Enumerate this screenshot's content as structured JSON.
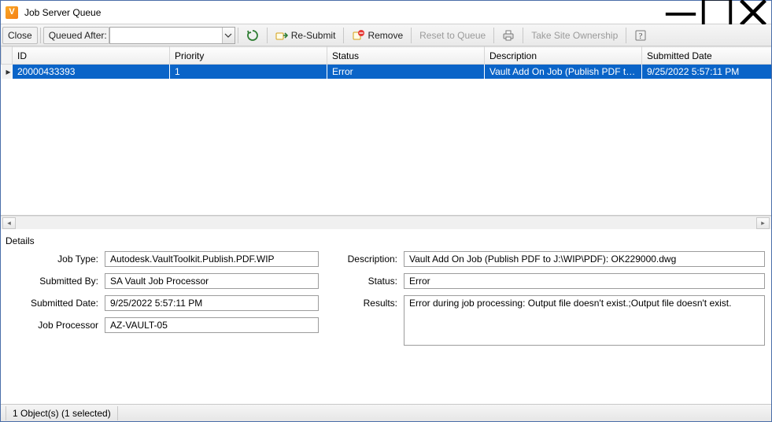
{
  "window": {
    "title": "Job Server Queue",
    "app_icon_letter": "V"
  },
  "toolbar": {
    "close": "Close",
    "queued_after": "Queued After:",
    "resubmit": "Re-Submit",
    "remove": "Remove",
    "reset": "Reset to Queue",
    "take_ownership": "Take Site Ownership"
  },
  "columns": {
    "id": "ID",
    "priority": "Priority",
    "status": "Status",
    "description": "Description",
    "submitted_date": "Submitted Date"
  },
  "rows": [
    {
      "id": "20000433393",
      "priority": "1",
      "status": "Error",
      "description": "Vault Add On Job (Publish PDF to J:...",
      "submitted_date": "9/25/2022 5:57:11 PM"
    }
  ],
  "details": {
    "header": "Details",
    "labels": {
      "job_type": "Job Type:",
      "submitted_by": "Submitted By:",
      "submitted_date": "Submitted Date:",
      "job_processor": "Job Processor",
      "description": "Description:",
      "status": "Status:",
      "results": "Results:"
    },
    "values": {
      "job_type": "Autodesk.VaultToolkit.Publish.PDF.WIP",
      "submitted_by": "SA Vault Job Processor",
      "submitted_date": "9/25/2022 5:57:11 PM",
      "job_processor": "AZ-VAULT-05",
      "description": "Vault Add On Job (Publish PDF to J:\\WIP\\PDF): OK229000.dwg",
      "status": "Error",
      "results": "Error during job processing: Output file doesn't exist.;Output file doesn't exist."
    }
  },
  "statusbar": {
    "count": "1 Object(s) (1 selected)"
  }
}
